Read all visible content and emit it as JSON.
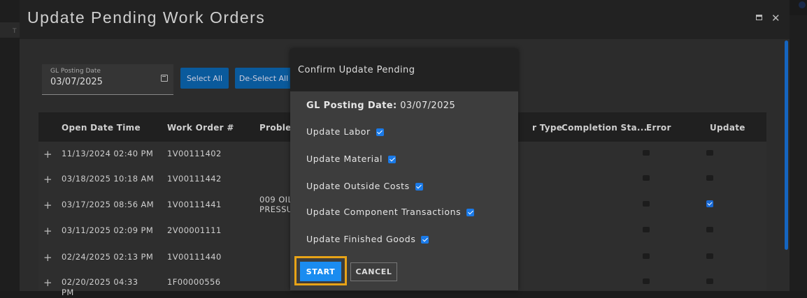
{
  "modal": {
    "title": "Update Pending Work Orders",
    "gl_posting_date_label": "GL Posting Date",
    "gl_posting_date_value": "03/07/2025",
    "select_all": "Select All",
    "deselect_all": "De-Select All"
  },
  "background": {
    "tab_fragment": "T"
  },
  "table": {
    "headers": [
      "Open Date Time",
      "Work Order #",
      "Problem",
      "r Type",
      "Completion Sta...",
      "Error",
      "Update"
    ],
    "rows": [
      {
        "open_date": "11/13/2024 02:40 PM",
        "work_order": "1V00111402",
        "problem": "",
        "error": false,
        "update": false
      },
      {
        "open_date": "03/18/2025 10:18 AM",
        "work_order": "1V00111442",
        "problem": "",
        "error": false,
        "update": false
      },
      {
        "open_date": "03/17/2025 08:56 AM",
        "work_order": "1V00111441",
        "problem": "009 OIL PRESSU",
        "error": false,
        "update": true
      },
      {
        "open_date": "03/11/2025 02:09 PM",
        "work_order": "2V00001111",
        "problem": "",
        "error": false,
        "update": false
      },
      {
        "open_date": "02/24/2025 02:13 PM",
        "work_order": "1V00111440",
        "problem": "",
        "error": false,
        "update": false
      },
      {
        "open_date": "02/20/2025 04:33 PM",
        "work_order": "1F00000556",
        "problem": "",
        "error": false,
        "update": false
      }
    ]
  },
  "dialog": {
    "title": "Confirm Update Pending",
    "gl_label": "GL Posting Date:",
    "gl_value": "03/07/2025",
    "options": [
      {
        "label": "Update Labor",
        "checked": true
      },
      {
        "label": "Update Material",
        "checked": true
      },
      {
        "label": "Update Outside Costs",
        "checked": true
      },
      {
        "label": "Update Component Transactions",
        "checked": true
      },
      {
        "label": "Update Finished Goods",
        "checked": true
      }
    ],
    "start": "START",
    "cancel": "CANCEL"
  },
  "colors": {
    "accent": "#1a8cf0",
    "highlight": "#e8a317",
    "button_blue": "#0a5a9c"
  },
  "icons": {
    "maximize": "maximize-icon",
    "close": "close-icon",
    "calendar": "calendar-icon",
    "expand": "plus-icon"
  }
}
